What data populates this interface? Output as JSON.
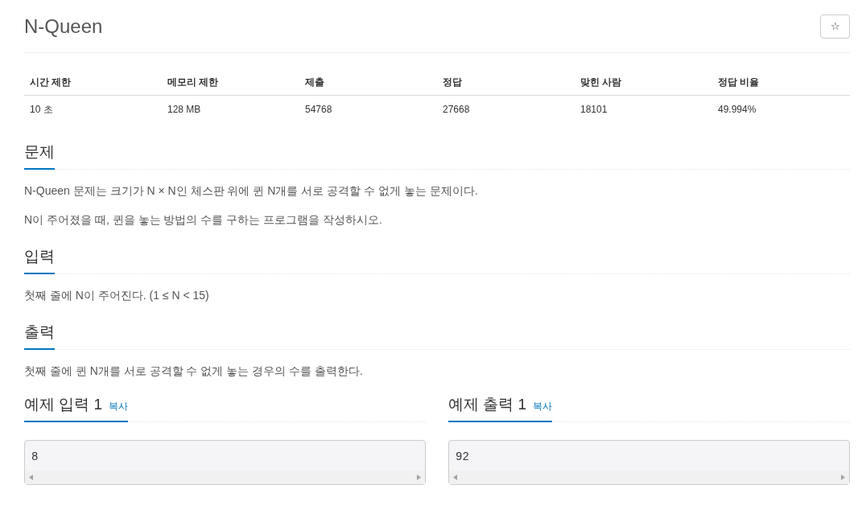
{
  "title": "N-Queen",
  "star_button": "☆",
  "info_table": {
    "columns": [
      "시간 제한",
      "메모리 제한",
      "제출",
      "정답",
      "맞힌 사람",
      "정답 비율"
    ],
    "rows": [
      [
        "10 초",
        "128 MB",
        "54768",
        "27668",
        "18101",
        "49.994%"
      ]
    ]
  },
  "sections": [
    {
      "heading": "문제",
      "paragraphs": [
        "N-Queen 문제는 크기가 N × N인 체스판 위에 퀸 N개를 서로 공격할 수 없게 놓는 문제이다.",
        "N이 주어졌을 때, 퀸을 놓는 방법의 수를 구하는 프로그램을 작성하시오."
      ]
    },
    {
      "heading": "입력",
      "paragraphs": [
        "첫째 줄에 N이 주어진다. (1 ≤ N < 15)"
      ]
    },
    {
      "heading": "출력",
      "paragraphs": [
        "첫째 줄에 퀸 N개를 서로 공격할 수 없게 놓는 경우의 수를 출력한다."
      ]
    }
  ],
  "samples": [
    {
      "heading": "예제 입력 1",
      "copy_link": "복사",
      "content": "8"
    },
    {
      "heading": "예제 출력 1",
      "copy_link": "복사",
      "content": "92"
    }
  ]
}
